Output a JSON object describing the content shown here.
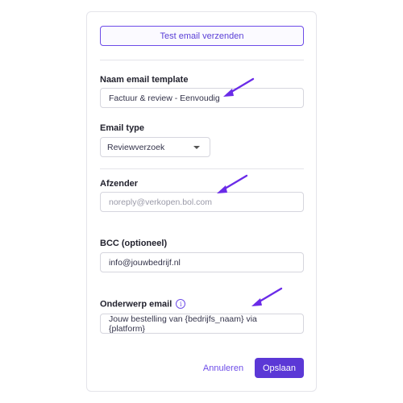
{
  "test_button_label": "Test email verzenden",
  "template_name": {
    "label": "Naam email template",
    "value": "Factuur & review - Eenvoudig"
  },
  "email_type": {
    "label": "Email type",
    "selected": "Reviewverzoek"
  },
  "sender": {
    "label": "Afzender",
    "placeholder": "noreply@verkopen.bol.com"
  },
  "bcc": {
    "label": "BCC (optioneel)",
    "value": "info@jouwbedrijf.nl"
  },
  "subject": {
    "label": "Onderwerp email",
    "info_icon_glyph": "i",
    "value": "Jouw bestelling van {bedrijfs_naam} via {platform}"
  },
  "actions": {
    "cancel_label": "Annuleren",
    "save_label": "Opslaan"
  },
  "colors": {
    "accent": "#5b38d6",
    "annotation_arrow": "#6a2be8"
  }
}
